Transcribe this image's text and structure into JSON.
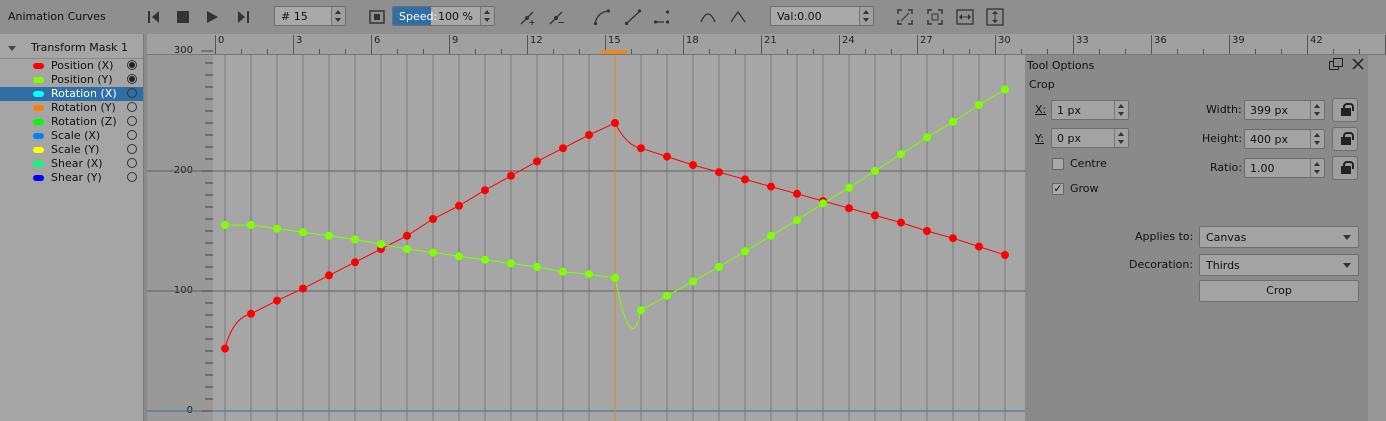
{
  "window": {
    "title": "Animation Curves"
  },
  "toolbar": {
    "frame_value": "# 15",
    "speed_label": "Speed:",
    "speed_value": "100 %",
    "value_field": "Val:0.00"
  },
  "channels": {
    "group_label": "Transform Mask 1",
    "items": [
      {
        "label": "Position (X)",
        "color": "#ff0000",
        "visible": true
      },
      {
        "label": "Position (Y)",
        "color": "#80ff00",
        "visible": true
      },
      {
        "label": "Rotation (X)",
        "color": "#00ffff",
        "visible": false,
        "selected": true
      },
      {
        "label": "Rotation (Y)",
        "color": "#ff8000",
        "visible": false
      },
      {
        "label": "Rotation (Z)",
        "color": "#00ff00",
        "visible": false
      },
      {
        "label": "Scale (X)",
        "color": "#0080ff",
        "visible": false
      },
      {
        "label": "Scale (Y)",
        "color": "#ffff00",
        "visible": false
      },
      {
        "label": "Shear (X)",
        "color": "#00ff80",
        "visible": false
      },
      {
        "label": "Shear (Y)",
        "color": "#0000ff",
        "visible": false
      }
    ]
  },
  "ruler": {
    "frames": [
      "0",
      "3",
      "6",
      "9",
      "12",
      "15",
      "18",
      "21",
      "24",
      "27",
      "30",
      "33",
      "36",
      "39",
      "42"
    ],
    "values": [
      "300",
      "200",
      "100",
      "0"
    ],
    "current_frame": 15
  },
  "curves": {
    "position_x": {
      "color": "#ff0000",
      "frames": [
        0,
        1,
        2,
        3,
        4,
        5,
        6,
        7,
        8,
        9,
        10,
        11,
        12,
        13,
        14,
        15,
        16,
        17,
        18,
        19,
        20,
        21,
        22,
        23,
        24,
        25,
        26,
        27,
        28,
        29,
        30
      ],
      "values": [
        52,
        81,
        92,
        102,
        113,
        124,
        135,
        146,
        160,
        171,
        184,
        196,
        208,
        219,
        230,
        240,
        219,
        212,
        205,
        199,
        193,
        187,
        181,
        175,
        169,
        163,
        157,
        150,
        144,
        137,
        130
      ]
    },
    "position_y": {
      "color": "#80ff00",
      "frames": [
        0,
        1,
        2,
        3,
        4,
        5,
        6,
        7,
        8,
        9,
        10,
        11,
        12,
        13,
        14,
        15,
        16,
        17,
        18,
        19,
        20,
        21,
        22,
        23,
        24,
        25,
        26,
        27,
        28,
        29,
        30
      ],
      "values": [
        155,
        155,
        152,
        149,
        146,
        143,
        139,
        135,
        132,
        129,
        126,
        123,
        120,
        116,
        114,
        111,
        84,
        96,
        108,
        120,
        133,
        146,
        159,
        173,
        186,
        200,
        214,
        228,
        241,
        255,
        268
      ]
    }
  },
  "tool_options": {
    "title": "Tool Options",
    "section": "Crop",
    "x_label": "X:",
    "x_value": "1 px",
    "y_label": "Y:",
    "y_value": "0 px",
    "width_label": "Width:",
    "width_value": "399 px",
    "height_label": "Height:",
    "height_value": "400 px",
    "ratio_label": "Ratio:",
    "ratio_value": "1.00",
    "centre_label": "Centre",
    "centre_checked": false,
    "grow_label": "Grow",
    "grow_checked": true,
    "grow_mark": "✓",
    "applies_label": "Applies to:",
    "applies_value": "Canvas",
    "decoration_label": "Decoration:",
    "decoration_value": "Thirds",
    "crop_button": "Crop"
  }
}
